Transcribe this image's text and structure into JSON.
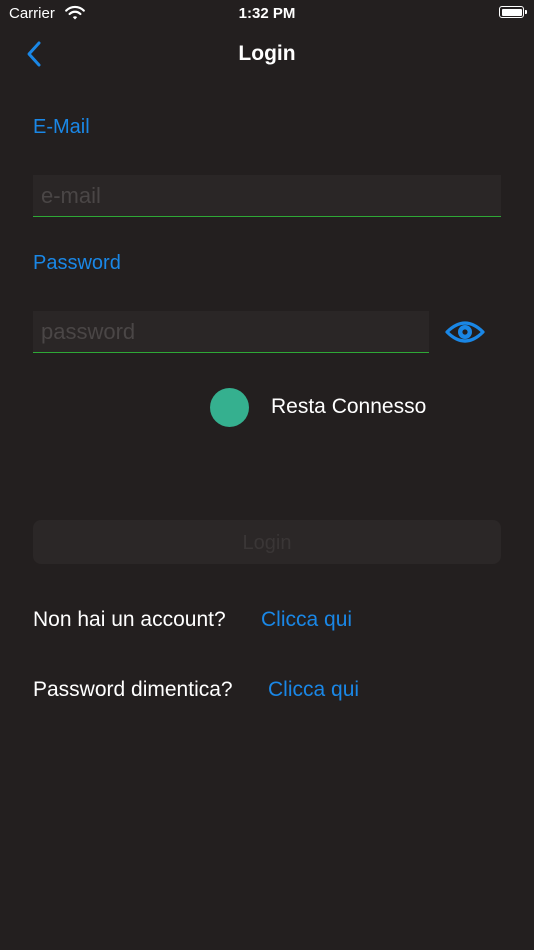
{
  "status_bar": {
    "carrier": "Carrier",
    "time": "1:32 PM"
  },
  "nav": {
    "title": "Login"
  },
  "email": {
    "label": "E-Mail",
    "placeholder": "e-mail",
    "value": ""
  },
  "password": {
    "label": "Password",
    "placeholder": "password",
    "value": ""
  },
  "stay_connected": {
    "label": "Resta Connesso"
  },
  "login_button": {
    "label": "Login"
  },
  "register": {
    "prompt": "Non hai un account?",
    "link": "Clicca qui"
  },
  "forgot": {
    "prompt": "Password dimentica?",
    "link": "Clicca qui"
  },
  "colors": {
    "background": "#231f1f",
    "accent": "#1a87e6",
    "toggle": "#35b08f",
    "field_underline": "#2ea836"
  }
}
